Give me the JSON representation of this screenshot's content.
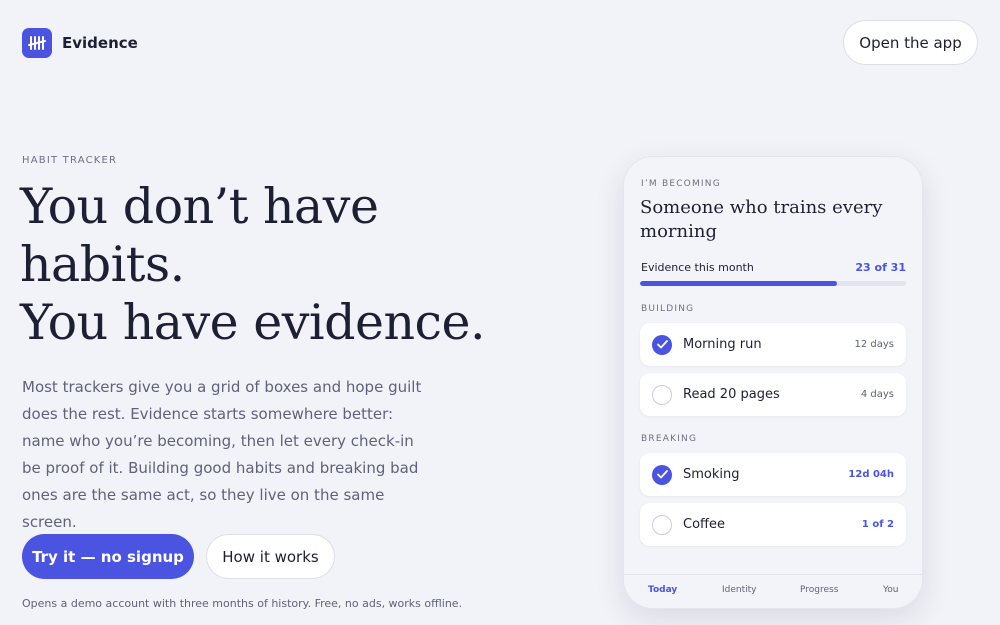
{
  "header": {
    "brand_name": "Evidence",
    "logo_icon": "tally-marks-icon",
    "open_app_label": "Open the app"
  },
  "hero": {
    "eyebrow": "HABIT TRACKER",
    "headline_lines": [
      "You don’t have",
      "habits.",
      "You have evidence."
    ],
    "lede": "Most trackers give you a grid of boxes and hope guilt does the rest. Evidence starts somewhere better: name who you’re becoming, then let every check-in be proof of it. Building good habits and breaking bad ones are the same act, so they live on the same screen.",
    "primary_cta": "Try it — no signup",
    "secondary_cta": "How it works",
    "fineprint": "Opens a demo account with three months of history. Free, no ads, works offline."
  },
  "phone": {
    "eyebrow": "I’M BECOMING",
    "identity": "Someone who trains every morning",
    "evidence_label": "Evidence this month",
    "evidence_count": "23 of 31",
    "evidence_progress": 0.74,
    "building_label": "BUILDING",
    "breaking_label": "BREAKING",
    "building": [
      {
        "name": "Morning run",
        "meta": "12 days",
        "checked": true
      },
      {
        "name": "Read 20 pages",
        "meta": "4 days",
        "checked": false
      }
    ],
    "breaking": [
      {
        "name": "Smoking",
        "meta": "12d 04h",
        "checked": true
      },
      {
        "name": "Coffee",
        "meta": "1 of 2",
        "checked": false
      }
    ],
    "tabs": [
      "Today",
      "Identity",
      "Progress",
      "You"
    ],
    "active_tab": "Today"
  },
  "colors": {
    "accent": "#4a54e1",
    "background": "#f2f3f8",
    "text": "#1d2033",
    "muted": "#5e6378"
  }
}
